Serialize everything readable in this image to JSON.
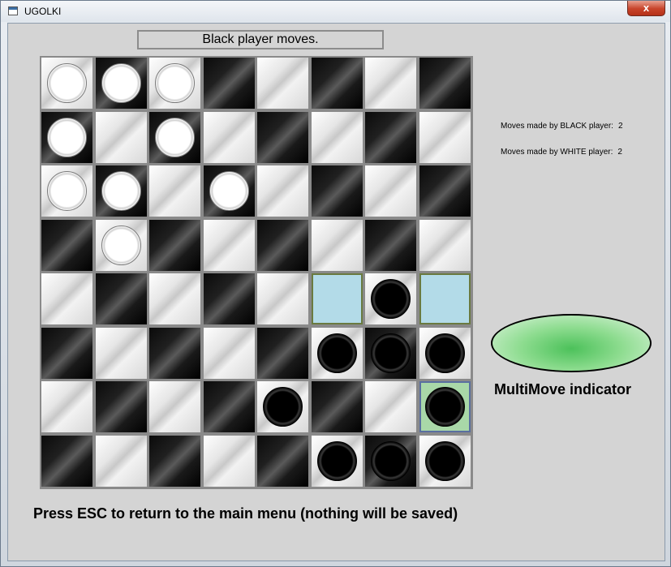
{
  "window": {
    "title": "UGOLKI",
    "close_label": "x"
  },
  "status": "Black player moves.",
  "board": {
    "rows": [
      [
        "W",
        "W",
        "W",
        "",
        "",
        "",
        "",
        ""
      ],
      [
        "W",
        "",
        "W",
        "",
        "",
        "",
        "",
        ""
      ],
      [
        "W",
        "W",
        "",
        "W",
        "",
        "",
        "",
        ""
      ],
      [
        "",
        "W",
        "",
        "",
        "",
        "",
        "",
        ""
      ],
      [
        "",
        "",
        "",
        "",
        "",
        "",
        "B",
        ""
      ],
      [
        "",
        "",
        "",
        "",
        "",
        "B",
        "B",
        "B"
      ],
      [
        "",
        "",
        "",
        "",
        "B",
        "",
        "",
        "B"
      ],
      [
        "",
        "",
        "",
        "",
        "",
        "B",
        "B",
        "B"
      ]
    ],
    "highlights": {
      "4-5": "blue",
      "4-7": "blue",
      "6-7": "green"
    }
  },
  "counters": {
    "black_label": "Moves made by BLACK player:",
    "black_value": "2",
    "white_label": "Moves made by WHITE player:",
    "white_value": "2"
  },
  "multimove": {
    "label": "MultiMove indicator",
    "color": "#4cc15a"
  },
  "hint": "Press ESC to return to the main menu (nothing will be saved)"
}
